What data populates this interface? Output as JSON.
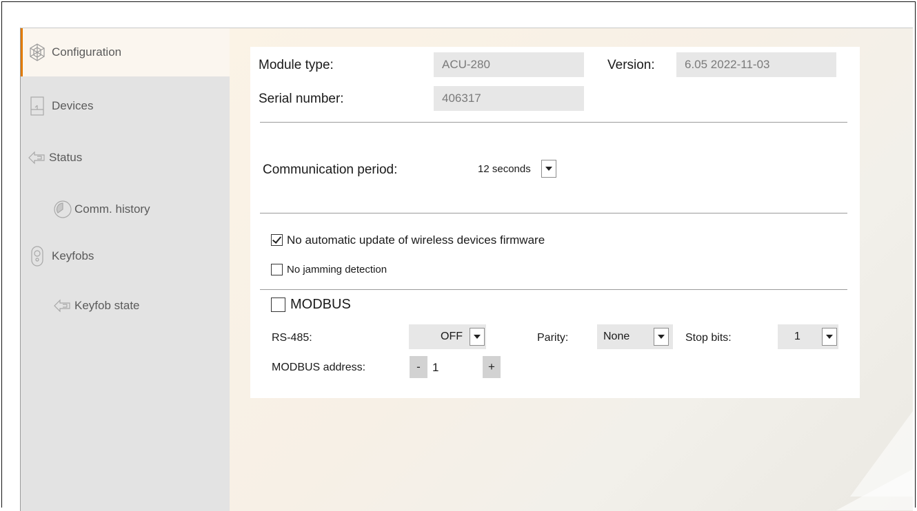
{
  "sidebar": {
    "items": [
      {
        "label": "Configuration",
        "icon": "configuration-icon",
        "active": true
      },
      {
        "label": "Devices",
        "icon": "devices-icon"
      },
      {
        "label": "Status",
        "icon": "status-icon"
      },
      {
        "label": "Comm. history",
        "icon": "comm-history-icon"
      },
      {
        "label": "Keyfobs",
        "icon": "keyfobs-icon"
      },
      {
        "label": "Keyfob state",
        "icon": "keyfob-state-icon"
      }
    ]
  },
  "module": {
    "type_label": "Module type:",
    "type_value": "ACU-280",
    "version_label": "Version:",
    "version_value": "6.05 2022-11-03",
    "serial_label": "Serial number:",
    "serial_value": "406317"
  },
  "communication": {
    "label": "Communication period:",
    "value": "12 seconds"
  },
  "options": {
    "no_auto_update": {
      "label": "No automatic update of wireless devices firmware",
      "checked": true
    },
    "no_jamming": {
      "label": "No jamming detection",
      "checked": false
    }
  },
  "modbus": {
    "label": "MODBUS",
    "enabled": false,
    "rs485_label": "RS-485:",
    "rs485_value": "OFF",
    "parity_label": "Parity:",
    "parity_value": "None",
    "stopbits_label": "Stop bits:",
    "stopbits_value": "1",
    "address_label": "MODBUS address:",
    "address_value": "1",
    "minus": "-",
    "plus": "+"
  },
  "colors": {
    "accent": "#e07a00",
    "sidebar_bg": "#e3e3e3",
    "active_bg": "#fbf6ef"
  }
}
